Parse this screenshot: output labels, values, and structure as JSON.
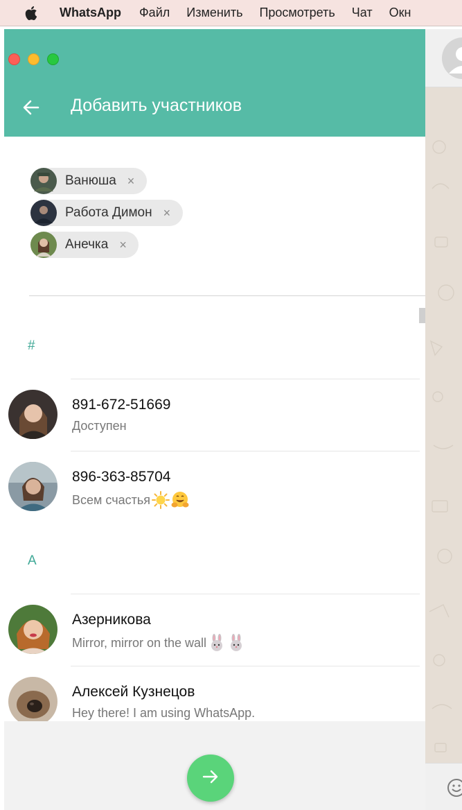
{
  "menubar": {
    "app": "WhatsApp",
    "items": [
      "Файл",
      "Изменить",
      "Просмотреть",
      "Чат",
      "Окн"
    ]
  },
  "header": {
    "title": "Добавить участников"
  },
  "chips": [
    {
      "name": "Ванюша",
      "remove": "×"
    },
    {
      "name": "Работа Димон",
      "remove": "×"
    },
    {
      "name": "Анечка",
      "remove": "×"
    }
  ],
  "sections": {
    "hash": "#",
    "a": "A"
  },
  "contacts": [
    {
      "name": "891-672-51669",
      "status": "Доступен"
    },
    {
      "name": "896-363-85704",
      "status": "Всем счастья"
    },
    {
      "name": "Азерникова",
      "status": "Mirror, mirror on the wall"
    },
    {
      "name": "Алексей Кузнецов",
      "status": "Hey there! I am using WhatsApp."
    }
  ],
  "colors": {
    "header": "#56bba6",
    "accent": "#3fa896",
    "fab": "#5ad47a"
  },
  "icons": {
    "back": "arrow-left-icon",
    "next": "arrow-right-icon",
    "remove": "close-icon"
  }
}
